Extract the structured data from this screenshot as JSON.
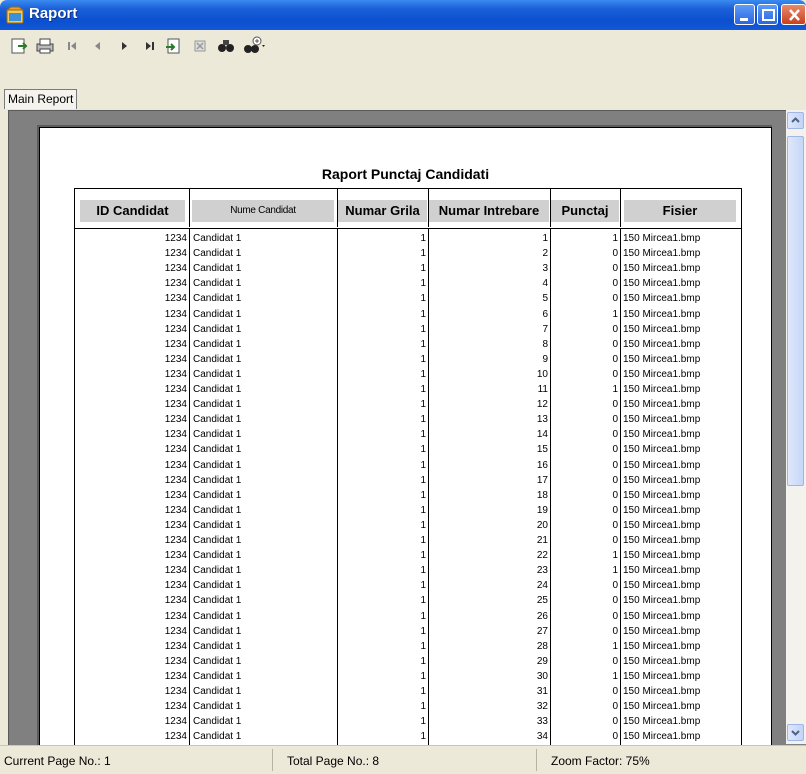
{
  "window": {
    "title": "Raport"
  },
  "tabs": [
    {
      "label": "Main Report"
    }
  ],
  "report": {
    "title": "Raport Punctaj Candidati",
    "columns": [
      "ID Candidat",
      "Nume Candidat",
      "Numar Grila",
      "Numar Intrebare",
      "Punctaj",
      "Fisier"
    ],
    "rows": [
      [
        "1234",
        "Candidat 1",
        "1",
        "1",
        "1",
        "150 Mircea1.bmp"
      ],
      [
        "1234",
        "Candidat 1",
        "1",
        "2",
        "0",
        "150 Mircea1.bmp"
      ],
      [
        "1234",
        "Candidat 1",
        "1",
        "3",
        "0",
        "150 Mircea1.bmp"
      ],
      [
        "1234",
        "Candidat 1",
        "1",
        "4",
        "0",
        "150 Mircea1.bmp"
      ],
      [
        "1234",
        "Candidat 1",
        "1",
        "5",
        "0",
        "150 Mircea1.bmp"
      ],
      [
        "1234",
        "Candidat 1",
        "1",
        "6",
        "1",
        "150 Mircea1.bmp"
      ],
      [
        "1234",
        "Candidat 1",
        "1",
        "7",
        "0",
        "150 Mircea1.bmp"
      ],
      [
        "1234",
        "Candidat 1",
        "1",
        "8",
        "0",
        "150 Mircea1.bmp"
      ],
      [
        "1234",
        "Candidat 1",
        "1",
        "9",
        "0",
        "150 Mircea1.bmp"
      ],
      [
        "1234",
        "Candidat 1",
        "1",
        "10",
        "0",
        "150 Mircea1.bmp"
      ],
      [
        "1234",
        "Candidat 1",
        "1",
        "11",
        "1",
        "150 Mircea1.bmp"
      ],
      [
        "1234",
        "Candidat 1",
        "1",
        "12",
        "0",
        "150 Mircea1.bmp"
      ],
      [
        "1234",
        "Candidat 1",
        "1",
        "13",
        "0",
        "150 Mircea1.bmp"
      ],
      [
        "1234",
        "Candidat 1",
        "1",
        "14",
        "0",
        "150 Mircea1.bmp"
      ],
      [
        "1234",
        "Candidat 1",
        "1",
        "15",
        "0",
        "150 Mircea1.bmp"
      ],
      [
        "1234",
        "Candidat 1",
        "1",
        "16",
        "0",
        "150 Mircea1.bmp"
      ],
      [
        "1234",
        "Candidat 1",
        "1",
        "17",
        "0",
        "150 Mircea1.bmp"
      ],
      [
        "1234",
        "Candidat 1",
        "1",
        "18",
        "0",
        "150 Mircea1.bmp"
      ],
      [
        "1234",
        "Candidat 1",
        "1",
        "19",
        "0",
        "150 Mircea1.bmp"
      ],
      [
        "1234",
        "Candidat 1",
        "1",
        "20",
        "0",
        "150 Mircea1.bmp"
      ],
      [
        "1234",
        "Candidat 1",
        "1",
        "21",
        "0",
        "150 Mircea1.bmp"
      ],
      [
        "1234",
        "Candidat 1",
        "1",
        "22",
        "1",
        "150 Mircea1.bmp"
      ],
      [
        "1234",
        "Candidat 1",
        "1",
        "23",
        "1",
        "150 Mircea1.bmp"
      ],
      [
        "1234",
        "Candidat 1",
        "1",
        "24",
        "0",
        "150 Mircea1.bmp"
      ],
      [
        "1234",
        "Candidat 1",
        "1",
        "25",
        "0",
        "150 Mircea1.bmp"
      ],
      [
        "1234",
        "Candidat 1",
        "1",
        "26",
        "0",
        "150 Mircea1.bmp"
      ],
      [
        "1234",
        "Candidat 1",
        "1",
        "27",
        "0",
        "150 Mircea1.bmp"
      ],
      [
        "1234",
        "Candidat 1",
        "1",
        "28",
        "1",
        "150 Mircea1.bmp"
      ],
      [
        "1234",
        "Candidat 1",
        "1",
        "29",
        "0",
        "150 Mircea1.bmp"
      ],
      [
        "1234",
        "Candidat 1",
        "1",
        "30",
        "1",
        "150 Mircea1.bmp"
      ],
      [
        "1234",
        "Candidat 1",
        "1",
        "31",
        "0",
        "150 Mircea1.bmp"
      ],
      [
        "1234",
        "Candidat 1",
        "1",
        "32",
        "0",
        "150 Mircea1.bmp"
      ],
      [
        "1234",
        "Candidat 1",
        "1",
        "33",
        "0",
        "150 Mircea1.bmp"
      ],
      [
        "1234",
        "Candidat 1",
        "1",
        "34",
        "0",
        "150 Mircea1.bmp"
      ]
    ]
  },
  "status": {
    "current_page": "Current Page No.: 1",
    "total_pages": "Total Page No.: 8",
    "zoom": "Zoom Factor: 75%"
  },
  "toolbar_icons": [
    "export-icon",
    "print-icon",
    "first-page-icon",
    "previous-page-icon",
    "next-page-icon",
    "last-page-icon",
    "goto-page-icon",
    "stop-icon",
    "search-icon",
    "zoom-icon"
  ],
  "colors": {
    "titlebar": "#0a4fcf",
    "header_cell": "#d0d0d0",
    "viewer_bg": "#808080"
  }
}
